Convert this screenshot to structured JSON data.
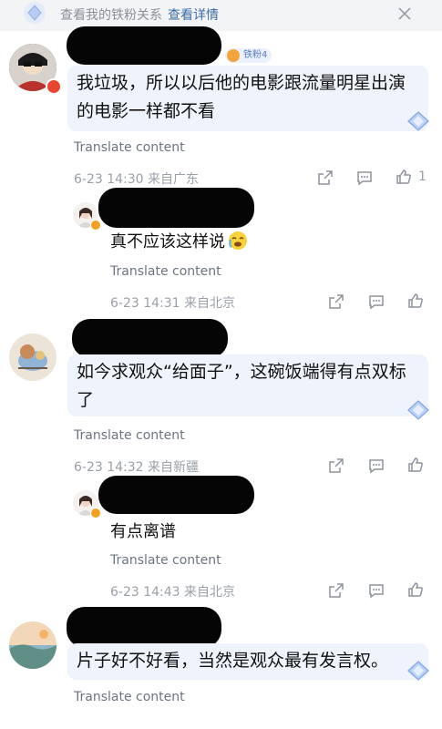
{
  "topbar": {
    "text": "查看我的铁粉关系",
    "link": "查看详情"
  },
  "comments": [
    {
      "badge": "铁粉4",
      "text": "我垃圾，所以以后他的电影跟流量明星出演的电影一样都不看",
      "translate": "Translate content",
      "meta": "6-23 14:30 来自广东",
      "likes": "1"
    },
    {
      "text": "真不应该这样说",
      "translate": "Translate content",
      "meta": "6-23 14:31 来自北京"
    },
    {
      "text": "如今求观众“给面子”，这碗饭端得有点双标了",
      "translate": "Translate content",
      "meta": "6-23 14:32 来自新疆"
    },
    {
      "text": "有点离谱",
      "translate": "Translate content",
      "meta": "6-23 14:43 来自北京"
    },
    {
      "text": "片子好不好看，当然是观众最有发言权。",
      "translate": "Translate content"
    }
  ],
  "icons": [
    "diamond-icon",
    "close-icon",
    "share-icon",
    "comment-icon",
    "like-icon",
    "crying-emoji-icon"
  ],
  "colors": {
    "bubble": "#eef3fc",
    "link": "#3a6aa8",
    "meta": "#9aa0a8",
    "redaction": "#050505"
  }
}
